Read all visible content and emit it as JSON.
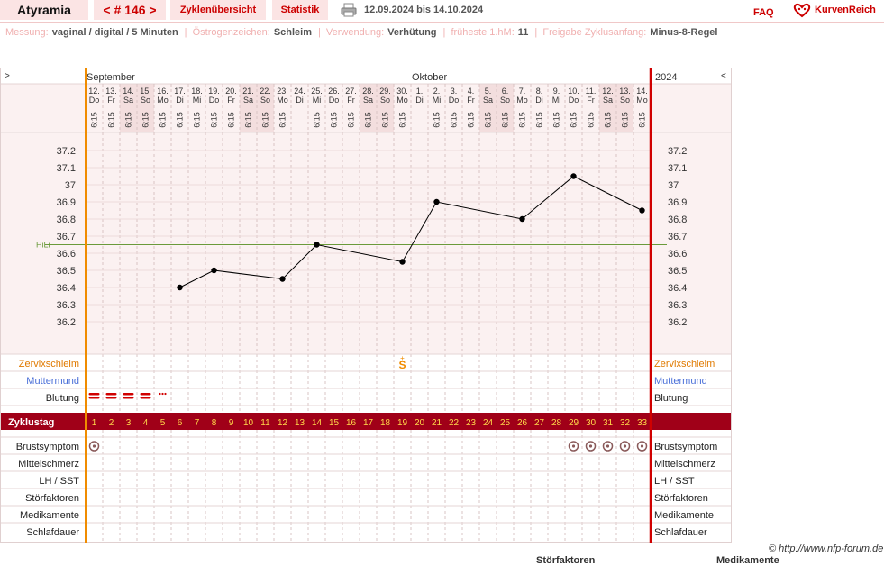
{
  "header": {
    "user": "Atyramia",
    "cycle_nav": "< # 146 >",
    "overview_tab": "Zyklenübersicht",
    "stats_tab": "Statistik",
    "date_range": "12.09.2024 bis 14.10.2024",
    "faq": "FAQ",
    "logo_text": "KurvenReich"
  },
  "info": {
    "measure_label": "Messung:",
    "measure_value": "vaginal / digital / 5 Minuten",
    "estrogen_label": "Östrogenzeichen:",
    "estrogen_value": "Schleim",
    "usage_label": "Verwendung:",
    "usage_value": "Verhütung",
    "earliest_label": "früheste 1.hM:",
    "earliest_value": "11",
    "release_label": "Freigabe Zyklusanfang:",
    "release_value": "Minus-8-Regel"
  },
  "chart_data": {
    "type": "line",
    "nav_left": ">",
    "nav_right": "<",
    "month_september": "September",
    "month_october": "Oktober",
    "year": "2024",
    "dates": [
      "12.",
      "13.",
      "14.",
      "15.",
      "16.",
      "17.",
      "18.",
      "19.",
      "20.",
      "21.",
      "22.",
      "23.",
      "24.",
      "25.",
      "26.",
      "27.",
      "28.",
      "29.",
      "30.",
      "1.",
      "2.",
      "3.",
      "4.",
      "5.",
      "6.",
      "7.",
      "8.",
      "9.",
      "10.",
      "11.",
      "12.",
      "13.",
      "14."
    ],
    "weekdays": [
      "Do",
      "Fr",
      "Sa",
      "So",
      "Mo",
      "Di",
      "Mi",
      "Do",
      "Fr",
      "Sa",
      "So",
      "Mo",
      "Di",
      "Mi",
      "Do",
      "Fr",
      "Sa",
      "So",
      "Mo",
      "Di",
      "Mi",
      "Do",
      "Fr",
      "Sa",
      "So",
      "Mo",
      "Di",
      "Mi",
      "Do",
      "Fr",
      "Sa",
      "So",
      "Mo"
    ],
    "weekend_days": [
      2,
      3,
      9,
      10,
      16,
      17,
      23,
      24,
      30,
      31
    ],
    "times": [
      "6:15",
      "6:15",
      "6:15",
      "6:15",
      "6:15",
      "6:15",
      "6:15",
      "6:15",
      "6:15",
      "6:15",
      "6:15",
      "6:15",
      "",
      "6:15",
      "6:15",
      "6:15",
      "6:15",
      "6:15",
      "6:15",
      "",
      "6:15",
      "6:15",
      "6:15",
      "6:15",
      "6:15",
      "6:15",
      "6:15",
      "6:15",
      "6:15",
      "6:15",
      "6:15",
      "6:15",
      "6:15"
    ],
    "y_ticks": [
      "37.2",
      "37.1",
      "37",
      "36.9",
      "36.8",
      "36.7",
      "36.6",
      "36.5",
      "36.4",
      "36.3",
      "36.2"
    ],
    "ylim": [
      36.1,
      37.3
    ],
    "hili_label": "HiLi",
    "hili_value": 36.65,
    "temperatures": [
      {
        "day": 6,
        "value": 36.4
      },
      {
        "day": 8,
        "value": 36.5
      },
      {
        "day": 12,
        "value": 36.45
      },
      {
        "day": 14,
        "value": 36.65
      },
      {
        "day": 19,
        "value": 36.55
      },
      {
        "day": 21,
        "value": 36.9
      },
      {
        "day": 26,
        "value": 36.8
      },
      {
        "day": 29,
        "value": 37.05
      },
      {
        "day": 33,
        "value": 36.85
      }
    ],
    "cycle_days": [
      "1",
      "2",
      "3",
      "4",
      "5",
      "6",
      "7",
      "8",
      "9",
      "10",
      "11",
      "12",
      "13",
      "14",
      "15",
      "16",
      "17",
      "18",
      "19",
      "20",
      "21",
      "22",
      "23",
      "24",
      "25",
      "26",
      "27",
      "28",
      "29",
      "30",
      "31",
      "32",
      "33"
    ],
    "rows": {
      "cervical_mucus": "Zervixschleim",
      "cervix": "Muttermund",
      "bleeding": "Blutung",
      "cycle_day": "Zyklustag",
      "breast": "Brustsymptom",
      "mittelschmerz": "Mittelschmerz",
      "lh": "LH / SST",
      "disturbances": "Störfaktoren",
      "medication": "Medikamente",
      "sleep": "Schlafdauer"
    },
    "mucus_mark": {
      "day": 19,
      "symbol": "S",
      "plus": "+"
    },
    "bleeding_heavy_days": [
      1,
      2,
      3,
      4
    ],
    "bleeding_spotting_days": [
      5
    ],
    "breast_symptom_days": [
      1,
      29,
      30,
      31,
      32,
      33
    ]
  },
  "colors": {
    "accent_red": "#cc0000",
    "cycle_bar": "#a00018",
    "orange": "#f08c00",
    "mucus_label": "#e07a00",
    "cervix_label": "#4a6fd8",
    "hili_line": "#6a9a3a",
    "weekend_bg": "#f3dede"
  },
  "footer": {
    "copyright": "© http://www.nfp-forum.de",
    "cut_label_1": "Störfaktoren",
    "cut_label_2": "Medikamente"
  }
}
